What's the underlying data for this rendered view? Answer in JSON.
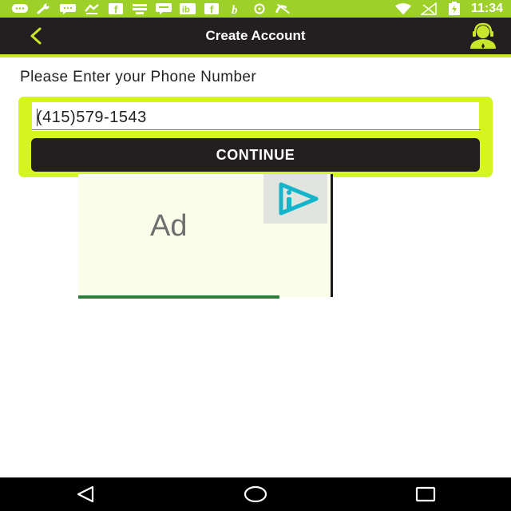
{
  "status_bar": {
    "time": "11:34",
    "background": "#9ed02a",
    "icons": [
      "chat-icon",
      "wrench-icon",
      "messenger-icon",
      "hands-icon",
      "facebook-icon",
      "drive-icon",
      "bubble-icon",
      "ibotta-icon",
      "facebook-icon",
      "b-icon",
      "circle-icon",
      "no-phone-icon",
      "wifi-icon",
      "signal-off-icon",
      "battery-charging-icon"
    ]
  },
  "app_bar": {
    "title": "Create Account",
    "background": "#231f20",
    "accent": "#c8e62a"
  },
  "form": {
    "prompt": "Please Enter your Phone Number",
    "phone_value": "(415)579-1543",
    "continue_label": "CONTINUE",
    "card_color": "#d4f51e"
  },
  "ad": {
    "label": "Ad"
  },
  "nav_bar": {
    "buttons": [
      "back-icon",
      "home-icon",
      "recents-icon"
    ]
  }
}
